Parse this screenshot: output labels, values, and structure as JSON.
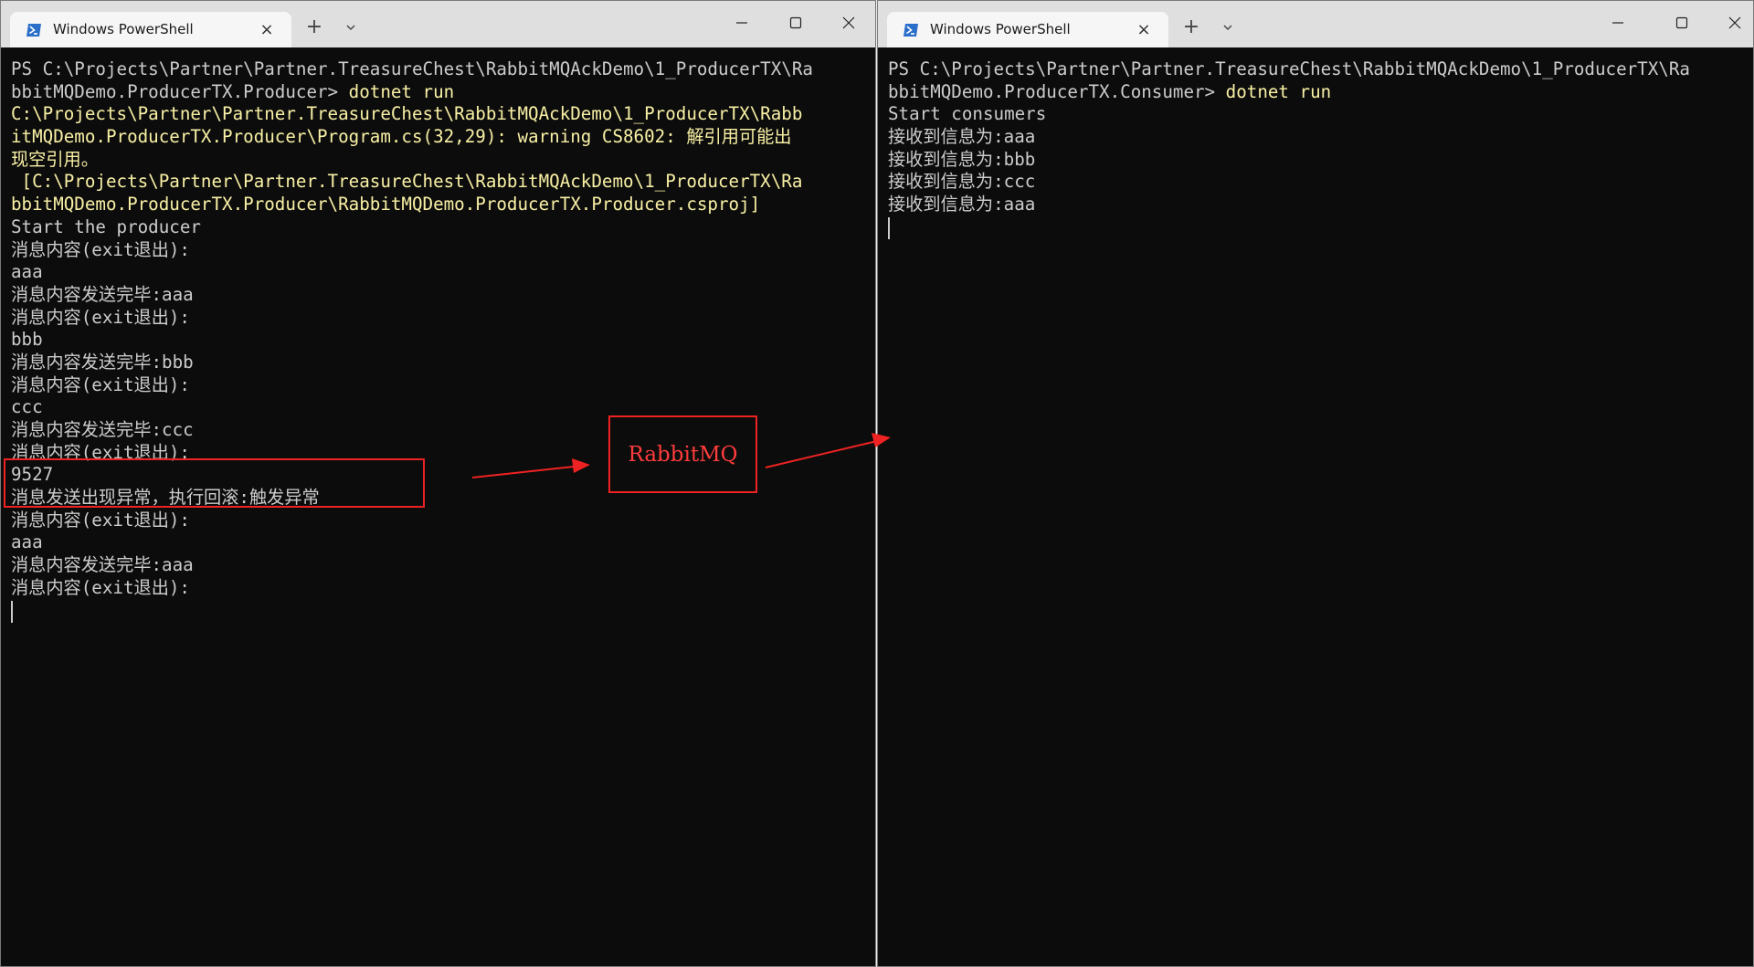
{
  "left_window": {
    "tab_title": "Windows PowerShell",
    "new_tab": "+",
    "close_glyph": "×",
    "prompt": "PS C:\\Projects\\Partner\\Partner.TreasureChest\\RabbitMQAckDemo\\1_ProducerTX\\Ra",
    "prompt_cont": "bbitMQDemo.ProducerTX.Producer> ",
    "command": "dotnet run",
    "warning_lines": [
      "C:\\Projects\\Partner\\Partner.TreasureChest\\RabbitMQAckDemo\\1_ProducerTX\\Rabb",
      "itMQDemo.ProducerTX.Producer\\Program.cs(32,29): warning CS8602: 解引用可能出",
      "现空引用。",
      " [C:\\Projects\\Partner\\Partner.TreasureChest\\RabbitMQAckDemo\\1_ProducerTX\\Ra",
      "bbitMQDemo.ProducerTX.Producer\\RabbitMQDemo.ProducerTX.Producer.csproj]"
    ],
    "output_lines": [
      "Start the producer",
      "消息内容(exit退出):",
      "aaa",
      "消息内容发送完毕:aaa",
      "消息内容(exit退出):",
      "bbb",
      "消息内容发送完毕:bbb",
      "消息内容(exit退出):",
      "ccc",
      "消息内容发送完毕:ccc",
      "消息内容(exit退出):",
      "9527",
      "消息发送出现异常，执行回滚:触发异常",
      "消息内容(exit退出):",
      "aaa",
      "消息内容发送完毕:aaa",
      "消息内容(exit退出):"
    ]
  },
  "right_window": {
    "tab_title": "Windows PowerShell",
    "new_tab": "+",
    "close_glyph": "×",
    "prompt": "PS C:\\Projects\\Partner\\Partner.TreasureChest\\RabbitMQAckDemo\\1_ProducerTX\\Ra",
    "prompt_cont": "bbitMQDemo.ProducerTX.Consumer> ",
    "command": "dotnet run",
    "output_lines": [
      "Start consumers",
      "接收到信息为:aaa",
      "接收到信息为:bbb",
      "接收到信息为:ccc",
      "接收到信息为:aaa"
    ]
  },
  "annotation": {
    "label": "RabbitMQ",
    "color": "#ee2222"
  },
  "colors": {
    "terminal_bg": "#0c0c0c",
    "terminal_text": "#cccccc",
    "command_text": "#f9f1a5",
    "powershell_icon": "#2a6fc9"
  },
  "icons": {
    "tab_icon": "powershell-icon",
    "minimize": "minimize-icon",
    "maximize": "maximize-icon",
    "close": "close-icon",
    "dropdown": "chevron-down-icon"
  }
}
